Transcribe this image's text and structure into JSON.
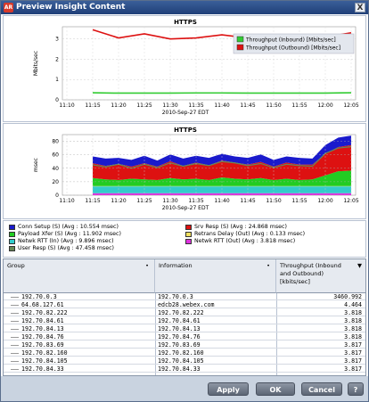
{
  "window": {
    "title": "Preview Insight Content",
    "logo_text": "AR",
    "close": "X"
  },
  "chart1": {
    "title": "HTTPS",
    "ylabel": "Mbits/sec",
    "xlabel": "2010-Sep-27 EDT",
    "yticks": [
      "0",
      "1",
      "2",
      "3"
    ],
    "xticks": [
      "11:10",
      "11:15",
      "11:20",
      "11:25",
      "11:30",
      "11:35",
      "11:40",
      "11:45",
      "11:50",
      "11:55",
      "12:00",
      "12:05"
    ],
    "legend": [
      {
        "label": "Throughput (Inbound) [Mbits/sec]",
        "color": "#33cc33"
      },
      {
        "label": "Throughput (Outbound) [Mbits/sec]",
        "color": "#dd1111"
      }
    ]
  },
  "chart2": {
    "title": "HTTPS",
    "ylabel": "msec",
    "xlabel": "2010-Sep-27 EDT",
    "yticks": [
      "0",
      "20",
      "40",
      "60",
      "80"
    ],
    "xticks": [
      "11:10",
      "11:15",
      "11:20",
      "11:25",
      "11:30",
      "11:35",
      "11:40",
      "11:45",
      "11:50",
      "11:55",
      "12:00",
      "12:05"
    ]
  },
  "legend2": [
    {
      "label": "Conn Setup (S) (Avg : 10.554 msec)",
      "color": "#1a1acc"
    },
    {
      "label": "Srv Resp (S) (Avg : 24.868 msec)",
      "color": "#dd1111"
    },
    {
      "label": "Payload Xfer (S) (Avg : 11.902 msec)",
      "color": "#22cc22"
    },
    {
      "label": "Retrans Delay (Out) (Avg : 0.133 msec)",
      "color": "#f0e060"
    },
    {
      "label": "Netwk RTT (In) (Avg : 9.896 msec)",
      "color": "#33cccc"
    },
    {
      "label": "Netwk RTT (Out) (Avg : 3.818 msec)",
      "color": "#dd33dd"
    },
    {
      "label": "User Resp (S) (Avg : 47.458 msec)",
      "color": "#668855"
    }
  ],
  "table": {
    "headers": {
      "group": "Group",
      "information": "Information",
      "throughput": "Throughput (Inbound and Outbound) [kbits/sec]",
      "sort_dot": "•",
      "sort_arrow": "▼"
    },
    "rows": [
      {
        "group": "192.70.0.3",
        "info": "192.70.0.3",
        "value": "3460.992"
      },
      {
        "group": "64.68.127.61",
        "info": "edcb28.webex.com",
        "value": "4.464"
      },
      {
        "group": "192.70.82.222",
        "info": "192.70.82.222",
        "value": "3.818"
      },
      {
        "group": "192.70.84.61",
        "info": "192.70.84.61",
        "value": "3.818"
      },
      {
        "group": "192.70.84.13",
        "info": "192.70.84.13",
        "value": "3.818"
      },
      {
        "group": "192.70.84.76",
        "info": "192.70.84.76",
        "value": "3.818"
      },
      {
        "group": "192.70.83.69",
        "info": "192.70.83.69",
        "value": "3.817"
      },
      {
        "group": "192.70.82.160",
        "info": "192.70.82.160",
        "value": "3.817"
      },
      {
        "group": "192.70.84.105",
        "info": "192.70.84.105",
        "value": "3.817"
      },
      {
        "group": "192.70.84.33",
        "info": "192.70.84.33",
        "value": "3.817"
      }
    ]
  },
  "buttons": {
    "apply": "Apply",
    "ok": "OK",
    "cancel": "Cancel",
    "help": "?"
  },
  "chart_data": [
    {
      "type": "line",
      "title": "HTTPS",
      "xlabel": "2010-Sep-27 EDT",
      "ylabel": "Mbits/sec",
      "x": [
        "11:10",
        "11:15",
        "11:20",
        "11:25",
        "11:30",
        "11:35",
        "11:40",
        "11:45",
        "11:50",
        "11:55",
        "12:00",
        "12:05"
      ],
      "ylim": [
        0,
        3.6
      ],
      "legend_position": "top-right",
      "series": [
        {
          "name": "Throughput (Inbound) [Mbits/sec]",
          "color": "#33cc33",
          "values": [
            null,
            0.35,
            0.33,
            0.33,
            0.33,
            0.34,
            0.34,
            0.33,
            0.33,
            0.33,
            0.33,
            0.35
          ]
        },
        {
          "name": "Throughput (Outbound) [Mbits/sec]",
          "color": "#dd1111",
          "values": [
            null,
            3.45,
            3.05,
            3.25,
            3.0,
            3.05,
            3.2,
            3.05,
            3.15,
            3.1,
            3.1,
            3.3
          ]
        }
      ]
    },
    {
      "type": "area",
      "title": "HTTPS",
      "xlabel": "2010-Sep-27 EDT",
      "ylabel": "msec",
      "x": [
        "11:10",
        "11:15",
        "11:17",
        "11:20",
        "11:22",
        "11:25",
        "11:27",
        "11:30",
        "11:32",
        "11:35",
        "11:37",
        "11:40",
        "11:42",
        "11:45",
        "11:47",
        "11:50",
        "11:52",
        "11:55",
        "11:57",
        "12:00",
        "12:02",
        "12:05"
      ],
      "ylim": [
        0,
        90
      ],
      "stacked": true,
      "series": [
        {
          "name": "Netwk RTT (Out) (Avg : 3.818 msec)",
          "color": "#dd33dd",
          "values": [
            null,
            3,
            3,
            3,
            3,
            3,
            3,
            3,
            3,
            3,
            3,
            3,
            3,
            3,
            3,
            3,
            3,
            3,
            3,
            3,
            3,
            3
          ]
        },
        {
          "name": "Netwk RTT (In) (Avg : 9.896 msec)",
          "color": "#33cccc",
          "values": [
            null,
            10,
            10,
            10,
            10,
            10,
            10,
            10,
            10,
            10,
            10,
            10,
            10,
            10,
            10,
            10,
            10,
            10,
            10,
            10,
            10,
            10
          ]
        },
        {
          "name": "Retrans Delay (Out) (Avg : 0.133 msec)",
          "color": "#f0e060",
          "values": [
            null,
            0.5,
            0.5,
            0.5,
            0.5,
            0.5,
            0.5,
            0.5,
            0.5,
            0.5,
            0.5,
            0.5,
            0.5,
            0.5,
            0.5,
            0.5,
            0.5,
            0.5,
            0.5,
            0.5,
            0.5,
            0.5
          ]
        },
        {
          "name": "Payload Xfer (S) (Avg : 11.902 msec)",
          "color": "#22cc22",
          "values": [
            null,
            12,
            10,
            9,
            11,
            10,
            9,
            12,
            10,
            11,
            9,
            13,
            11,
            10,
            12,
            9,
            11,
            9,
            10,
            16,
            22,
            23
          ]
        },
        {
          "name": "Srv Resp (S) (Avg : 24.868 msec)",
          "color": "#dd1111",
          "values": [
            null,
            22,
            20,
            24,
            18,
            24,
            20,
            25,
            20,
            24,
            22,
            25,
            24,
            22,
            24,
            20,
            24,
            23,
            22,
            32,
            36,
            38
          ]
        },
        {
          "name": "Conn Setup (S) (Avg : 10.554 msec)",
          "color": "#1a1acc",
          "values": [
            null,
            10,
            11,
            9,
            10,
            11,
            9,
            10,
            11,
            10,
            11,
            10,
            9,
            10,
            11,
            10,
            9,
            10,
            9,
            13,
            14,
            14
          ]
        },
        {
          "name": "User Resp (S) (Avg : 47.458 msec)",
          "color": "#668855",
          "values": [
            null,
            45,
            42,
            46,
            40,
            46,
            41,
            48,
            43,
            47,
            44,
            50,
            48,
            44,
            47,
            41,
            46,
            44,
            43,
            62,
            70,
            72
          ]
        }
      ]
    }
  ]
}
